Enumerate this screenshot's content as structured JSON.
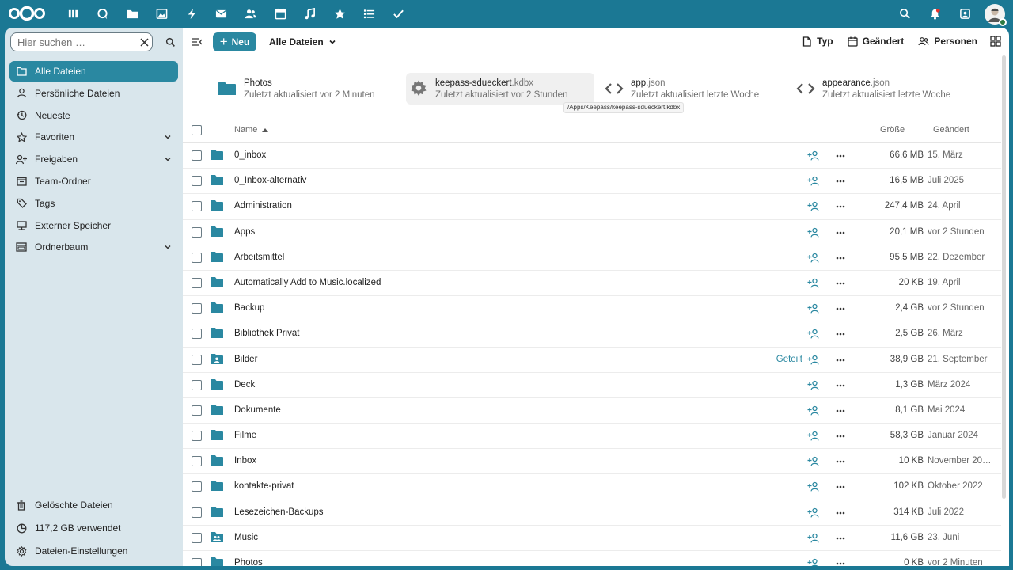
{
  "topbar": {
    "apps": [
      "dashboard-icon",
      "talk-icon",
      "files-icon",
      "photos-icon",
      "activity-icon",
      "mail-icon",
      "contacts-icon",
      "calendar-icon",
      "music-icon",
      "bookmarks-icon",
      "tasks-icon",
      "deck-icon"
    ],
    "right": [
      "search-icon",
      "notifications-icon",
      "contacts-menu-icon"
    ]
  },
  "sidebar": {
    "search": {
      "placeholder": "Hier suchen …"
    },
    "items": [
      {
        "label": "Alle Dateien",
        "icon": "folder-icon",
        "active": true
      },
      {
        "label": "Persönliche Dateien",
        "icon": "user-icon"
      },
      {
        "label": "Neueste",
        "icon": "history-icon"
      },
      {
        "label": "Favoriten",
        "icon": "star-icon",
        "expandable": true
      },
      {
        "label": "Freigaben",
        "icon": "share-icon",
        "expandable": true
      },
      {
        "label": "Team-Ordner",
        "icon": "team-folder-icon"
      },
      {
        "label": "Tags",
        "icon": "tag-icon"
      },
      {
        "label": "Externer Speicher",
        "icon": "external-storage-icon"
      },
      {
        "label": "Ordnerbaum",
        "icon": "folder-tree-icon",
        "expandable": true
      }
    ],
    "bottom": [
      {
        "label": "Gelöschte Dateien",
        "icon": "trash-icon"
      },
      {
        "label": "117,2 GB verwendet",
        "icon": "pie-chart-icon"
      },
      {
        "label": "Dateien-Einstellungen",
        "icon": "settings-icon"
      }
    ]
  },
  "toolbar": {
    "new_label": "Neu",
    "breadcrumb": "Alle Dateien",
    "filters": [
      "Typ",
      "Geändert",
      "Personen"
    ]
  },
  "recent": [
    {
      "name": "Photos",
      "ext": "",
      "sub": "Zuletzt aktualisiert vor 2 Minuten",
      "icon": "folder-icon"
    },
    {
      "name": "keepass-sdueckert",
      "ext": ".kdbx",
      "sub": "Zuletzt aktualisiert vor 2 Stunden",
      "icon": "gear-icon"
    },
    {
      "name": "app",
      "ext": ".json",
      "sub": "Zuletzt aktualisiert letzte Woche",
      "icon": "code-icon"
    },
    {
      "name": "appearance",
      "ext": ".json",
      "sub": "Zuletzt aktualisiert letzte Woche",
      "icon": "code-icon"
    }
  ],
  "tooltip": "/Apps/Keepass/keepass-sdueckert.kdbx",
  "table": {
    "headers": {
      "name": "Name",
      "size": "Größe",
      "modified": "Geändert"
    },
    "rows": [
      {
        "name": "0_inbox",
        "size": "66,6 MB",
        "modified": "15. März",
        "type": "folder"
      },
      {
        "name": "0_Inbox-alternativ",
        "size": "16,5 MB",
        "modified": "Juli 2025",
        "type": "folder"
      },
      {
        "name": "Administration",
        "size": "247,4 MB",
        "modified": "24. April",
        "type": "folder"
      },
      {
        "name": "Apps",
        "size": "20,1 MB",
        "modified": "vor 2 Stunden",
        "type": "folder"
      },
      {
        "name": "Arbeitsmittel",
        "size": "95,5 MB",
        "modified": "22. Dezember",
        "type": "folder"
      },
      {
        "name": "Automatically Add to Music.localized",
        "size": "20 KB",
        "modified": "19. April",
        "type": "folder"
      },
      {
        "name": "Backup",
        "size": "2,4 GB",
        "modified": "vor 2 Stunden",
        "type": "folder"
      },
      {
        "name": "Bibliothek Privat",
        "size": "2,5 GB",
        "modified": "26. März",
        "type": "folder"
      },
      {
        "name": "Bilder",
        "size": "38,9 GB",
        "modified": "21. September",
        "type": "shared-folder",
        "shared": "Geteilt"
      },
      {
        "name": "Deck",
        "size": "1,3 GB",
        "modified": "März 2024",
        "type": "folder"
      },
      {
        "name": "Dokumente",
        "size": "8,1 GB",
        "modified": "Mai 2024",
        "type": "folder"
      },
      {
        "name": "Filme",
        "size": "58,3 GB",
        "modified": "Januar 2024",
        "type": "folder"
      },
      {
        "name": "Inbox",
        "size": "10 KB",
        "modified": "November 20…",
        "type": "folder"
      },
      {
        "name": "kontakte-privat",
        "size": "102 KB",
        "modified": "Oktober 2022",
        "type": "folder"
      },
      {
        "name": "Lesezeichen-Backups",
        "size": "314 KB",
        "modified": "Juli 2022",
        "type": "folder"
      },
      {
        "name": "Music",
        "size": "11,6 GB",
        "modified": "23. Juni",
        "type": "group-folder"
      },
      {
        "name": "Photos",
        "size": "0 KB",
        "modified": "vor 2 Minuten",
        "type": "folder"
      }
    ]
  }
}
